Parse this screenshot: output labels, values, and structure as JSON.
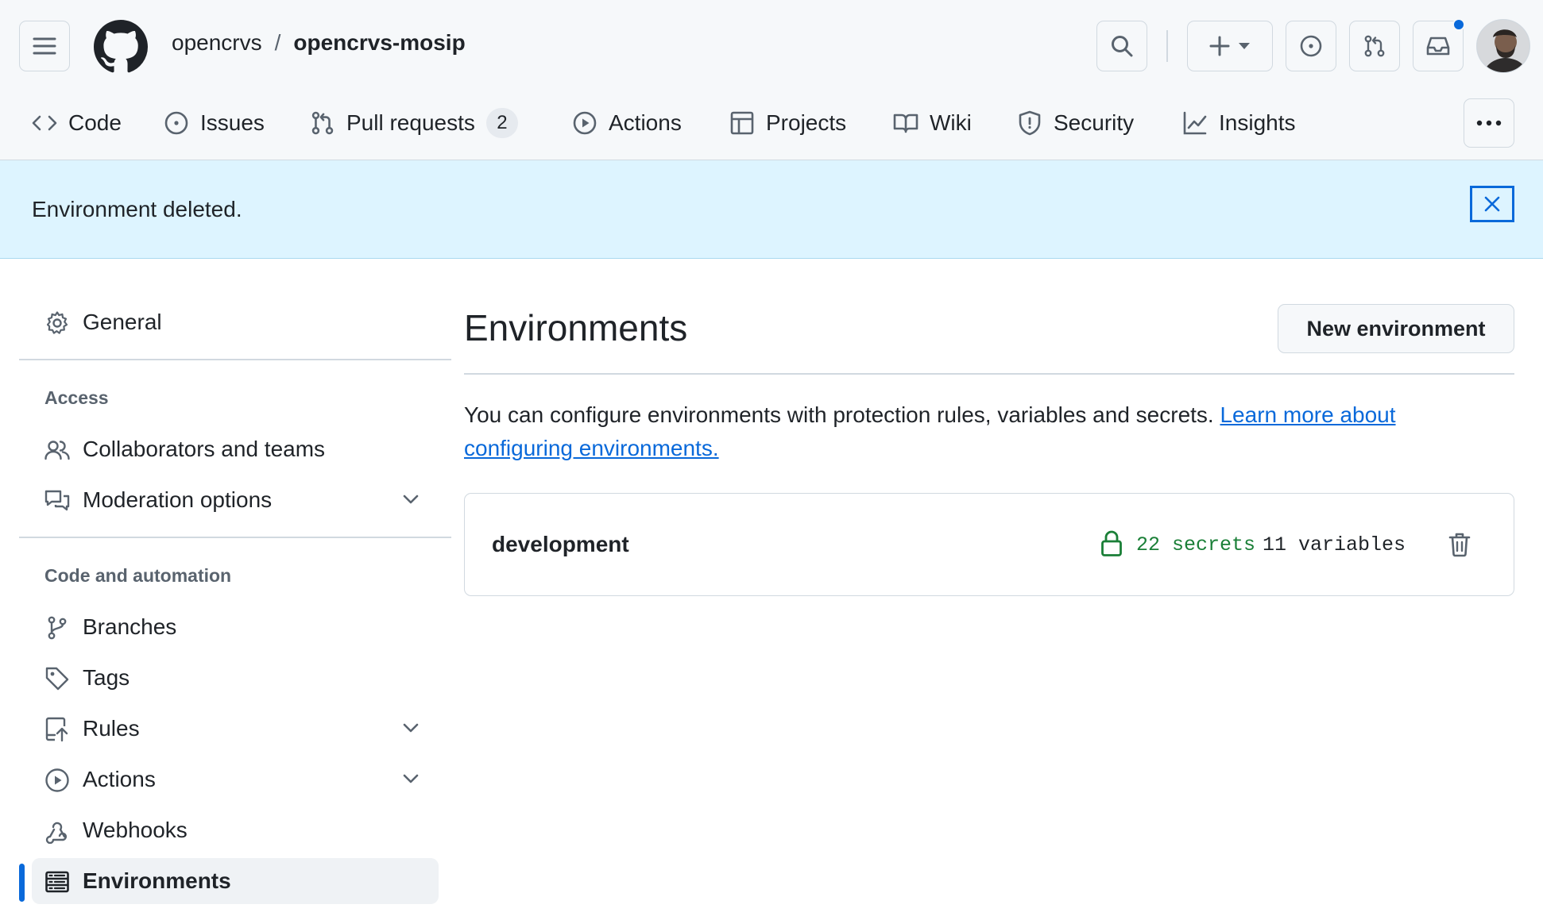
{
  "header": {
    "owner": "opencrvs",
    "separator": "/",
    "repo": "opencrvs-mosip"
  },
  "repo_nav": {
    "tabs": [
      {
        "label": "Code",
        "icon": "code-icon"
      },
      {
        "label": "Issues",
        "icon": "issue-opened-icon"
      },
      {
        "label": "Pull requests",
        "icon": "git-pull-request-icon",
        "count": "2"
      },
      {
        "label": "Actions",
        "icon": "play-icon"
      },
      {
        "label": "Projects",
        "icon": "table-icon"
      },
      {
        "label": "Wiki",
        "icon": "book-icon"
      },
      {
        "label": "Security",
        "icon": "shield-icon"
      },
      {
        "label": "Insights",
        "icon": "graph-icon"
      }
    ]
  },
  "flash": {
    "message": "Environment deleted."
  },
  "sidebar": {
    "general": "General",
    "access_header": "Access",
    "access_items": [
      {
        "label": "Collaborators and teams",
        "icon": "people-icon"
      },
      {
        "label": "Moderation options",
        "icon": "comment-discussion-icon"
      }
    ],
    "code_header": "Code and automation",
    "code_items": [
      {
        "label": "Branches",
        "icon": "git-branch-icon"
      },
      {
        "label": "Tags",
        "icon": "tag-icon"
      },
      {
        "label": "Rules",
        "icon": "repo-push-icon"
      },
      {
        "label": "Actions",
        "icon": "play-icon"
      },
      {
        "label": "Webhooks",
        "icon": "webhook-icon"
      },
      {
        "label": "Environments",
        "icon": "server-icon"
      }
    ],
    "active": "Environments"
  },
  "main": {
    "title": "Environments",
    "new_button": "New environment",
    "description": "You can configure environments with protection rules, variables and secrets. ",
    "learn_more": "Learn more about configuring environments.",
    "environments": [
      {
        "name": "development",
        "secrets": "22 secrets",
        "variables": "11 variables"
      }
    ]
  },
  "colors": {
    "accent": "#0969da",
    "flash_bg": "#ddf4ff",
    "success": "#1a7f37",
    "header_bg": "#f6f8fa"
  }
}
